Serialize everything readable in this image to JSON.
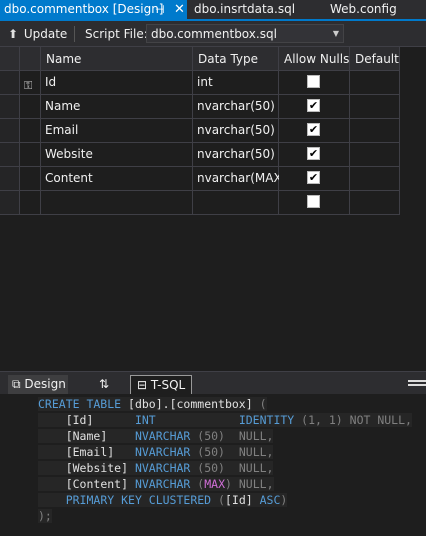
{
  "tabs": [
    {
      "label": "dbo.commentbox [Design]",
      "active": true
    },
    {
      "label": "dbo.insrtdata.sql",
      "active": false
    },
    {
      "label": "Web.config",
      "active": false
    }
  ],
  "toolbar": {
    "update_label": "Update",
    "script_file_label": "Script File:",
    "script_file_value": "dbo.commentbox.sql"
  },
  "grid": {
    "columns": [
      "Name",
      "Data Type",
      "Allow Nulls",
      "Default"
    ],
    "rows": [
      {
        "name": "Id",
        "type": "int",
        "allow_nulls": false,
        "is_key": true
      },
      {
        "name": "Name",
        "type": "nvarchar(50)",
        "allow_nulls": true,
        "is_key": false
      },
      {
        "name": "Email",
        "type": "nvarchar(50)",
        "allow_nulls": true,
        "is_key": false
      },
      {
        "name": "Website",
        "type": "nvarchar(50)",
        "allow_nulls": true,
        "is_key": false
      },
      {
        "name": "Content",
        "type": "nvarchar(MAX)",
        "allow_nulls": true,
        "is_key": false
      },
      {
        "name": "",
        "type": "",
        "allow_nulls": false,
        "is_key": false
      }
    ]
  },
  "pane_tabs": {
    "design_label": "Design",
    "swap_label": "⇅",
    "tsql_label": "T-SQL"
  },
  "sql": {
    "line1": {
      "kw": "CREATE TABLE",
      "obj": "[dbo].[commentbox]",
      "paren": "("
    },
    "line2": {
      "col": "[Id]",
      "type": "INT",
      "identity": "IDENTITY",
      "args": "(1, 1)",
      "notnull": "NOT NULL,"
    },
    "line3": {
      "col": "[Name]",
      "type": "NVARCHAR",
      "size": "(50)",
      "null": "NULL,"
    },
    "line4": {
      "col": "[Email]",
      "type": "NVARCHAR",
      "size": "(50)",
      "null": "NULL,"
    },
    "line5": {
      "col": "[Website]",
      "type": "NVARCHAR",
      "size": "(50)",
      "null": "NULL,"
    },
    "line6": {
      "col": "[Content]",
      "type": "NVARCHAR",
      "size_open": "(",
      "size": "MAX",
      "size_close": ")",
      "null": "NULL,"
    },
    "line7": {
      "kw": "PRIMARY KEY CLUSTERED",
      "open": "(",
      "col": "[Id]",
      "asc": "ASC",
      "close": ")"
    },
    "line8": ");"
  },
  "colors": {
    "accent": "#007acc",
    "background": "#1e1e1e",
    "keyword": "#569cd6",
    "max_keyword": "#d16fd8"
  },
  "icons": [
    "pin-icon",
    "close-icon",
    "update-icon",
    "dropdown-arrow-icon",
    "primary-key-icon",
    "design-icon",
    "swap-icon",
    "tsql-icon",
    "checkbox-checked-icon"
  ]
}
